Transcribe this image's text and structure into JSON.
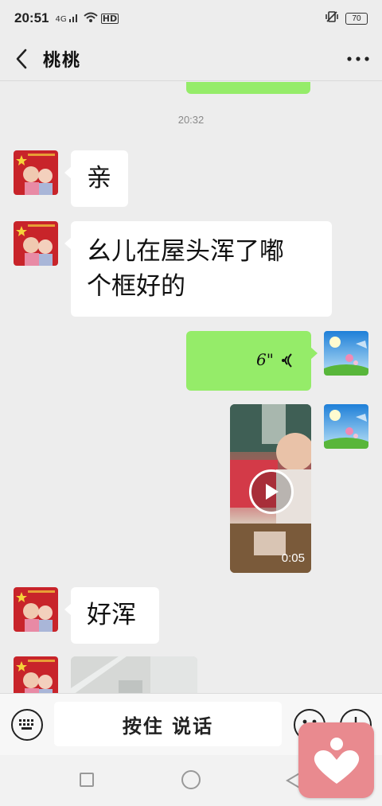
{
  "status_bar": {
    "time": "20:51",
    "signal_label": "4G",
    "hd_label": "HD",
    "battery": "70"
  },
  "header": {
    "title": "桃桃"
  },
  "chat": {
    "timestamp": "20:32",
    "messages": [
      {
        "side": "left",
        "type": "text",
        "text": "亲"
      },
      {
        "side": "left",
        "type": "text",
        "line1": "幺儿在屋头浑了嘟",
        "line2": "个框好的"
      },
      {
        "side": "right",
        "type": "voice",
        "duration": "6\""
      },
      {
        "side": "right",
        "type": "video",
        "duration": "0:05"
      },
      {
        "side": "left",
        "type": "text",
        "text": "好浑"
      },
      {
        "side": "left",
        "type": "image"
      }
    ]
  },
  "input_bar": {
    "hold_to_talk": "按住 说话"
  },
  "colors": {
    "sent_bubble": "#95ec69",
    "received_bubble": "#ffffff",
    "background": "#ededed",
    "floating_app": "#e98a8f"
  },
  "icons": [
    "back-arrow-icon",
    "more-dots-icon",
    "keyboard-icon",
    "emoji-icon",
    "plus-icon",
    "voice-wave-icon",
    "play-icon",
    "heart-app-icon"
  ]
}
